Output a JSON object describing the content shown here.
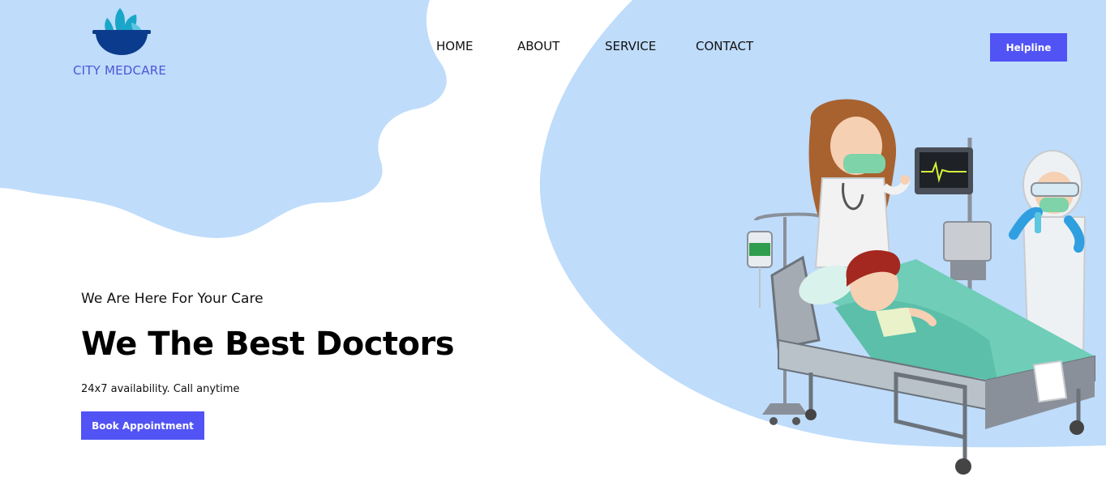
{
  "brand": {
    "name": "CITY MEDCARE",
    "icon": "leaf-bowl-logo-icon",
    "text_color": "#4f55d8",
    "icon_colors": [
      "#1aa6c9",
      "#0b3b8c"
    ]
  },
  "nav": {
    "items": [
      {
        "label": "HOME"
      },
      {
        "label": "ABOUT"
      },
      {
        "label": "SERVICE"
      },
      {
        "label": "CONTACT"
      }
    ]
  },
  "header": {
    "helpline_label": "Helpline"
  },
  "hero": {
    "tagline": "We Are Here For Your Care",
    "headline": "We The Best Doctors",
    "availability": "24x7 availability. Call anytime",
    "cta_label": "Book Appointment",
    "illustration": "hospital-bed-doctors-illustration"
  },
  "colors": {
    "accent": "#5153f5",
    "blob": "#bfdcfb",
    "background": "#ffffff"
  }
}
